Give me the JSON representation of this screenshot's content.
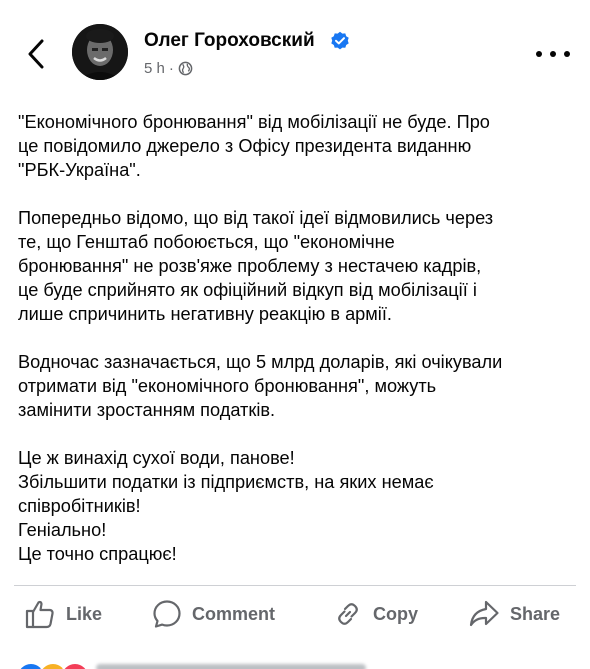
{
  "header": {
    "author_name": "Олег Гороховский",
    "time": "5 h",
    "separator": "·",
    "audience_icon": "globe-icon",
    "back_icon": "chevron-left-icon",
    "more_icon": "more-horizontal-icon"
  },
  "post": {
    "paragraphs": [
      [
        "\"Економічного бронювання\" від мобілізації не буде. Про",
        "це повідомило джерело з Офісу президента виданню",
        "\"РБК-Україна\"."
      ],
      [
        "Попередньо відомо, що від такої ідеї відмовились через",
        "те, що Генштаб побоюється, що \"економічне",
        "бронювання\" не розв'яже проблему з нестачею кадрів,",
        "це буде сприйнято як офіційний відкуп від мобілізації і",
        "лише спричинить негативну реакцію в армії."
      ],
      [
        "Водночас зазначається, що 5 млрд доларів, які очікували",
        "отримати від \"економічного бронювання\", можуть",
        "замінити зростанням податків."
      ],
      [
        "Це ж винахід сухої води, панове!",
        "Збільшити податки із підприємств, на яких немає",
        "співробітників!",
        "Геніально!",
        "Це точно спрацює!"
      ]
    ]
  },
  "actions": {
    "like_label": "Like",
    "comment_label": "Comment",
    "copy_label": "Copy",
    "share_label": "Share"
  },
  "colors": {
    "text": "#050505",
    "secondary": "#65676b",
    "verified": "#1877f2",
    "divider": "#ced0d4"
  }
}
